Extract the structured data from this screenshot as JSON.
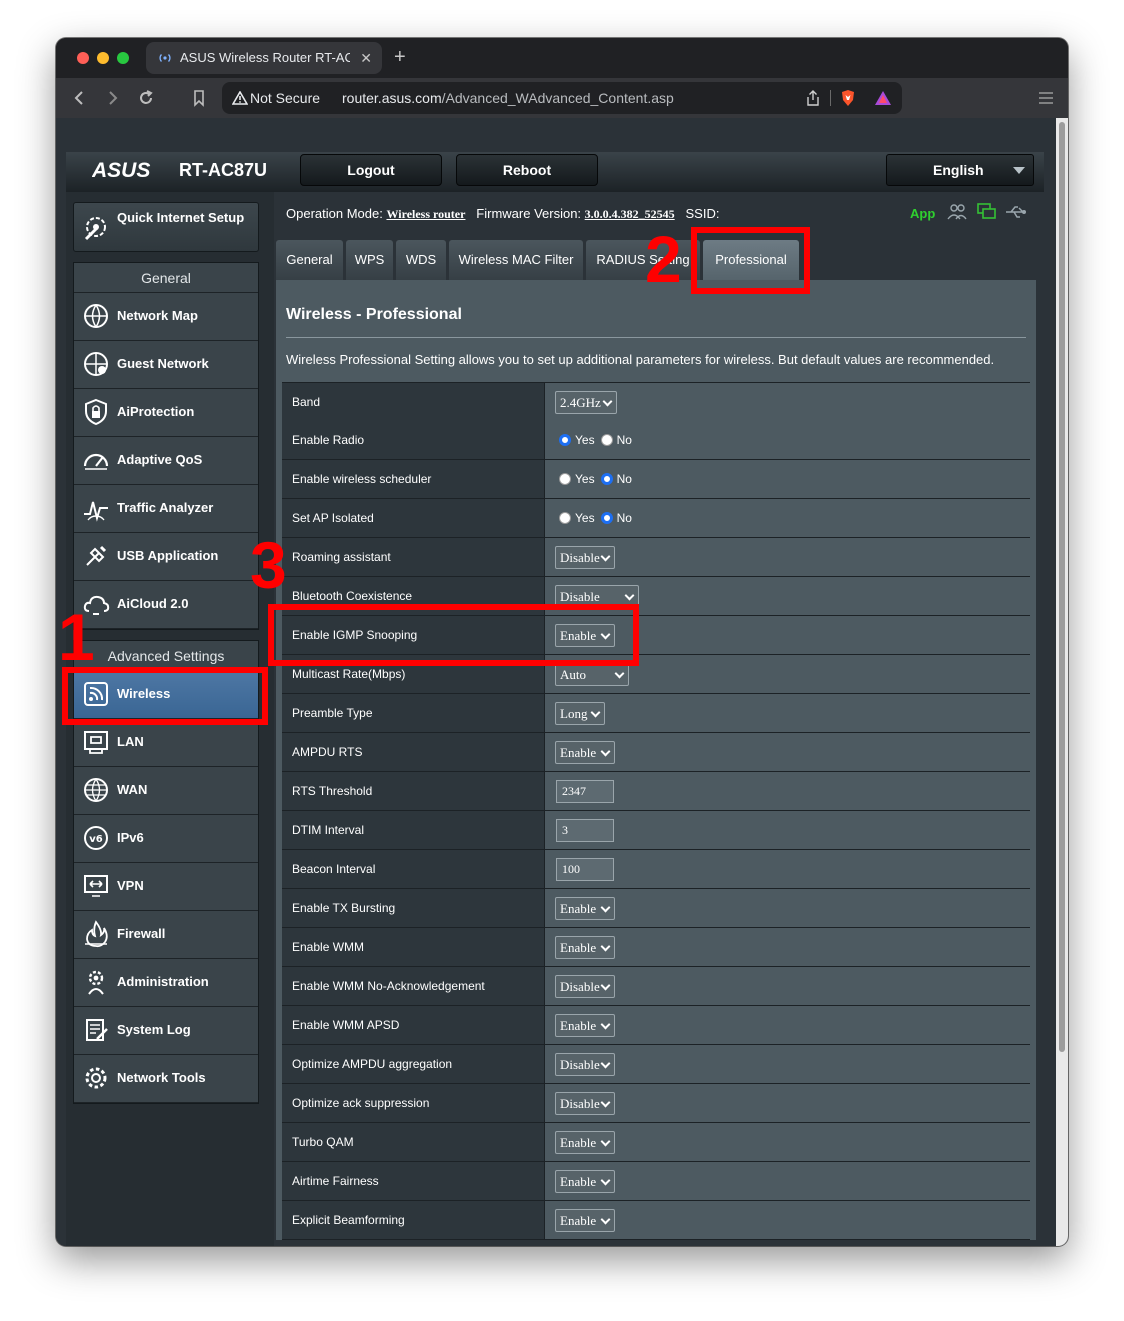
{
  "browser": {
    "tab_title": "ASUS Wireless Router RT-AC87U",
    "close_glyph": "✕",
    "new_tab_glyph": "+",
    "security_label": "Not Secure",
    "url_host": "router.asus.com",
    "url_path": "/Advanced_WAdvanced_Content.asp"
  },
  "header": {
    "brand": "ASUS",
    "model": "RT-AC87U",
    "logout": "Logout",
    "reboot": "Reboot",
    "language": "English"
  },
  "status": {
    "operation_mode_label": "Operation Mode:",
    "operation_mode": "Wireless router",
    "firmware_label": "Firmware Version:",
    "firmware": "3.0.0.4.382_52545",
    "ssid_label": "SSID:",
    "app": "App"
  },
  "sidebar": {
    "quick_setup": "Quick Internet Setup",
    "general_title": "General",
    "general": [
      {
        "label": "Network Map",
        "icon": "network-map-icon"
      },
      {
        "label": "Guest Network",
        "icon": "guest-network-icon"
      },
      {
        "label": "AiProtection",
        "icon": "shield-lock-icon"
      },
      {
        "label": "Adaptive QoS",
        "icon": "speedometer-icon"
      },
      {
        "label": "Traffic Analyzer",
        "icon": "traffic-analyzer-icon"
      },
      {
        "label": "USB Application",
        "icon": "usb-icon"
      },
      {
        "label": "AiCloud 2.0",
        "icon": "cloud-icon"
      }
    ],
    "advanced_title": "Advanced Settings",
    "advanced": [
      {
        "label": "Wireless",
        "icon": "wireless-icon",
        "active": true
      },
      {
        "label": "LAN",
        "icon": "lan-icon"
      },
      {
        "label": "WAN",
        "icon": "globe-icon"
      },
      {
        "label": "IPv6",
        "icon": "ipv6-icon"
      },
      {
        "label": "VPN",
        "icon": "vpn-icon"
      },
      {
        "label": "Firewall",
        "icon": "firewall-icon"
      },
      {
        "label": "Administration",
        "icon": "gear-person-icon"
      },
      {
        "label": "System Log",
        "icon": "system-log-icon"
      },
      {
        "label": "Network Tools",
        "icon": "network-tools-icon"
      }
    ]
  },
  "tabs": [
    "General",
    "WPS",
    "WDS",
    "Wireless MAC Filter",
    "RADIUS Setting",
    "Professional"
  ],
  "panel": {
    "title": "Wireless - Professional",
    "description": "Wireless Professional Setting allows you to set up additional parameters for wireless. But default values are recommended."
  },
  "settings": [
    {
      "label": "Band",
      "type": "select",
      "value": "2.4GHz"
    },
    {
      "label": "Enable Radio",
      "type": "radio",
      "yes": "Yes",
      "no": "No",
      "value": "Yes"
    },
    {
      "label": "Enable wireless scheduler",
      "type": "radio",
      "yes": "Yes",
      "no": "No",
      "value": "No"
    },
    {
      "label": "Set AP Isolated",
      "type": "radio",
      "yes": "Yes",
      "no": "No",
      "value": "No"
    },
    {
      "label": "Roaming assistant",
      "type": "select",
      "value": "Disable"
    },
    {
      "label": "Bluetooth Coexistence",
      "type": "select",
      "value": "Disable"
    },
    {
      "label": "Enable IGMP Snooping",
      "type": "select",
      "value": "Enable"
    },
    {
      "label": "Multicast Rate(Mbps)",
      "type": "select",
      "value": "Auto"
    },
    {
      "label": "Preamble Type",
      "type": "select",
      "value": "Long"
    },
    {
      "label": "AMPDU RTS",
      "type": "select",
      "value": "Enable"
    },
    {
      "label": "RTS Threshold",
      "type": "text",
      "value": "2347"
    },
    {
      "label": "DTIM Interval",
      "type": "text",
      "value": "3"
    },
    {
      "label": "Beacon Interval",
      "type": "text",
      "value": "100"
    },
    {
      "label": "Enable TX Bursting",
      "type": "select",
      "value": "Enable"
    },
    {
      "label": "Enable WMM",
      "type": "select",
      "value": "Enable"
    },
    {
      "label": "Enable WMM No-Acknowledgement",
      "type": "select",
      "value": "Disable"
    },
    {
      "label": "Enable WMM APSD",
      "type": "select",
      "value": "Enable"
    },
    {
      "label": "Optimize AMPDU aggregation",
      "type": "select",
      "value": "Disable"
    },
    {
      "label": "Optimize ack suppression",
      "type": "select",
      "value": "Disable"
    },
    {
      "label": "Turbo QAM",
      "type": "select",
      "value": "Enable"
    },
    {
      "label": "Airtime Fairness",
      "type": "select",
      "value": "Enable"
    },
    {
      "label": "Explicit Beamforming",
      "type": "select",
      "value": "Enable"
    }
  ],
  "annotations": [
    "1",
    "2",
    "3"
  ],
  "colors": {
    "annotation": "#ff0000",
    "active_menu": "#4e77a4",
    "app_link": "#2fd12f",
    "radio_selected": "#1d6ff3"
  }
}
